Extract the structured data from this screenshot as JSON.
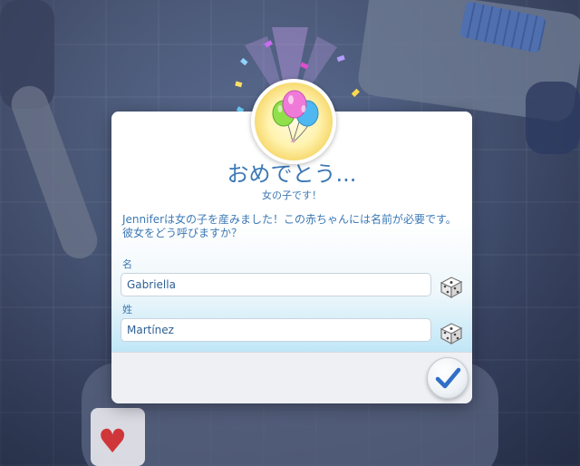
{
  "dialog": {
    "title": "おめでとう...",
    "subtitle": "女の子です！",
    "message": "Jenniferは女の子を産みました！この赤ちゃんには名前が必要です。彼女をどう呼びますか？",
    "first_name_label": "名",
    "first_name_value": "Gabriella",
    "last_name_label": "姓",
    "last_name_value": "Martínez",
    "confirm_icon": "checkmark-icon",
    "randomize_icon": "dice-icon",
    "badge_icon": "balloons-icon"
  },
  "colors": {
    "accent_text": "#3c78b5",
    "confirm_check": "#2f6fc7",
    "badge_gold": "#f6d667"
  }
}
